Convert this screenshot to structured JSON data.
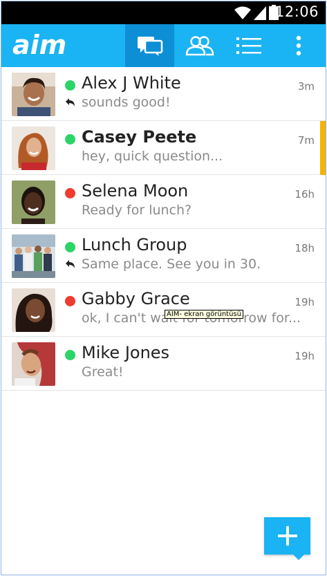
{
  "status_bar": {
    "time": "12:06",
    "icons": [
      "wifi-icon",
      "signal-icon",
      "battery-icon"
    ]
  },
  "app_bar": {
    "logo": "aim",
    "tabs": [
      {
        "icon": "chat-bubbles-icon",
        "active": true
      },
      {
        "icon": "buddies-icon",
        "active": false
      },
      {
        "icon": "list-icon",
        "active": false
      },
      {
        "icon": "overflow-menu-icon",
        "active": false
      }
    ],
    "accent_color": "#1ab3f3",
    "active_tab_color": "#0d8fd6"
  },
  "conversations": [
    {
      "name": "Alex J White",
      "time": "3m",
      "preview": "sounds good!",
      "presence": "online",
      "replied": true,
      "bold": false,
      "unread": false
    },
    {
      "name": "Casey Peete",
      "time": "7m",
      "preview": "hey, quick question...",
      "presence": "online",
      "replied": false,
      "bold": true,
      "unread": true
    },
    {
      "name": "Selena Moon",
      "time": "16h",
      "preview": "Ready for lunch?",
      "presence": "busy",
      "replied": false,
      "bold": false,
      "unread": false
    },
    {
      "name": "Lunch Group",
      "time": "18h",
      "preview": "Same place. See you in 30.",
      "presence": "online",
      "replied": true,
      "bold": false,
      "unread": false
    },
    {
      "name": "Gabby Grace",
      "time": "19h",
      "preview": "ok, I can't wait for tomorrow for...",
      "presence": "busy",
      "replied": false,
      "bold": false,
      "unread": false
    },
    {
      "name": "Mike Jones",
      "time": "19h",
      "preview": "Great!",
      "presence": "online",
      "replied": false,
      "bold": false,
      "unread": false
    }
  ],
  "presence_colors": {
    "online": "#2bd567",
    "busy": "#f03b2e"
  },
  "unread_color": "#f5b300",
  "tooltip": "AIM- ekran görüntüsü",
  "fab": {
    "icon": "plus-icon"
  }
}
